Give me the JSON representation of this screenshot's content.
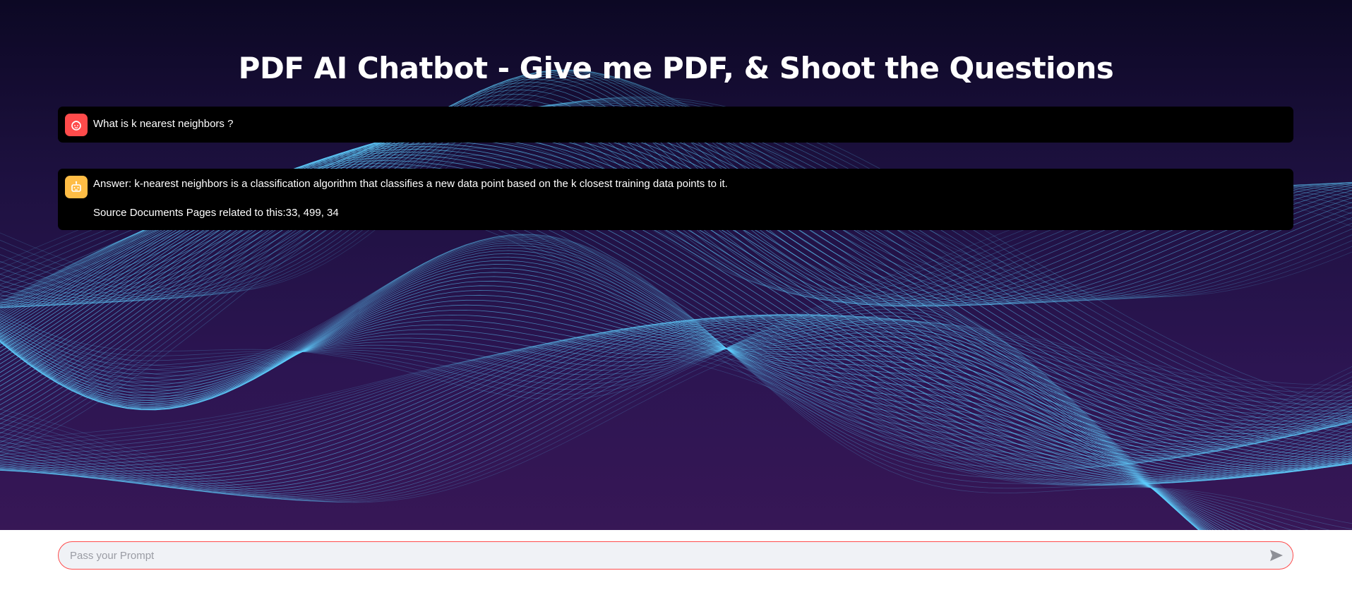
{
  "page": {
    "title": "PDF AI Chatbot - Give me PDF, & Shoot the Questions"
  },
  "messages": [
    {
      "role": "user",
      "avatar_icon": "user-face-icon",
      "text": "What is k nearest neighbors ?"
    },
    {
      "role": "assistant",
      "avatar_icon": "robot-icon",
      "answer": "Answer: k-nearest neighbors is a classification algorithm that classifies a new data point based on the k closest training data points to it.",
      "sources": "Source Documents Pages related to this:33, 499, 34"
    }
  ],
  "chat_input": {
    "placeholder": "Pass your Prompt",
    "value": "",
    "send_icon": "send-arrow-icon"
  },
  "colors": {
    "background_dark": "#1e1141",
    "wave_cyan": "#5fd0ff",
    "user_avatar": "#ff4b4b",
    "assistant_avatar": "#ffbd45",
    "input_border": "#ff4b4b",
    "input_background": "#f0f2f6"
  }
}
